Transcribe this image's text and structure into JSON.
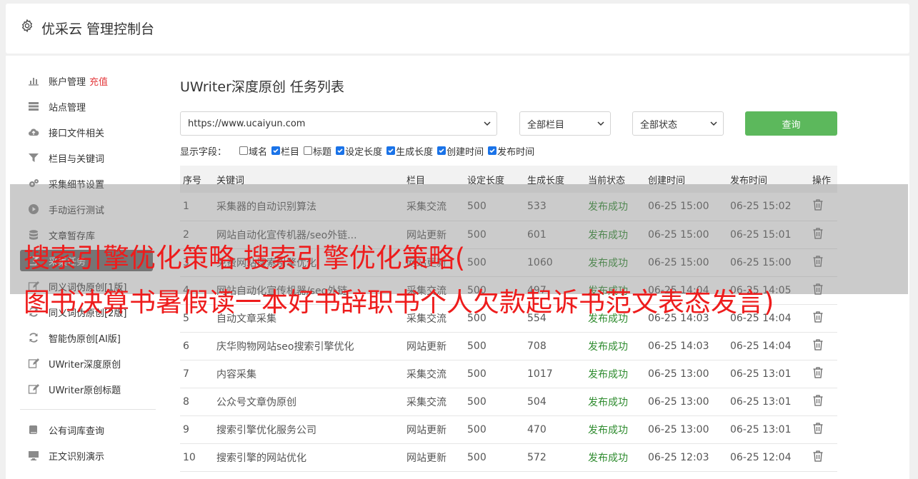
{
  "header": {
    "brand": "优采云 管理控制台",
    "icon": "gear-icon"
  },
  "sidebar": {
    "items": [
      {
        "label": "账户管理",
        "extra": "充值",
        "icon": "bar-chart-icon"
      },
      {
        "label": "站点管理",
        "icon": "server-icon"
      },
      {
        "label": "接口文件相关",
        "icon": "cloud-upload-icon"
      },
      {
        "label": "栏目与关键词",
        "icon": "filter-icon"
      },
      {
        "label": "采集细节设置",
        "icon": "gears-icon"
      },
      {
        "label": "手动运行测试",
        "icon": "play-icon"
      },
      {
        "label": "文章暂存库",
        "icon": "database-icon"
      },
      {
        "label": "采集任务",
        "icon": "edit-icon",
        "active": true
      },
      {
        "label": "同义词伪原创[1版]",
        "icon": "edit-icon"
      },
      {
        "label": "同义词伪原创[2版]",
        "icon": "refresh-icon"
      },
      {
        "label": "智能伪原创[AI版]",
        "icon": "refresh-icon"
      },
      {
        "label": "UWriter深度原创",
        "icon": "edit-icon"
      },
      {
        "label": "UWriter原创标题",
        "icon": "edit-icon"
      }
    ],
    "items2": [
      {
        "label": "公有词库查询",
        "icon": "book-icon"
      },
      {
        "label": "正文识别演示",
        "icon": "monitor-icon"
      }
    ]
  },
  "main": {
    "title": "UWriter深度原创 任务列表",
    "site_select": "https://www.ucaiyun.com",
    "column_select": "全部栏目",
    "status_select": "全部状态",
    "query_label": "查询",
    "fields_label": "显示字段：",
    "fields": [
      {
        "label": "域名",
        "checked": false
      },
      {
        "label": "栏目",
        "checked": true
      },
      {
        "label": "标题",
        "checked": false
      },
      {
        "label": "设定长度",
        "checked": true
      },
      {
        "label": "生成长度",
        "checked": true
      },
      {
        "label": "创建时间",
        "checked": true
      },
      {
        "label": "发布时间",
        "checked": true
      }
    ],
    "table": {
      "headers": [
        "序号",
        "关键词",
        "栏目",
        "设定长度",
        "生成长度",
        "当前状态",
        "创建时间",
        "发布时间",
        "操作"
      ],
      "rows": [
        [
          "1",
          "采集器的自动识别算法",
          "采集交流",
          "500",
          "533",
          "发布成功",
          "06-25 15:00",
          "06-25 15:02"
        ],
        [
          "2",
          "网站自动化宣传机器/seo外链...",
          "网站更新",
          "500",
          "601",
          "发布成功",
          "06-25 15:00",
          "06-25 15:01"
        ],
        [
          "3",
          "免费网站搜索引擎优化",
          "网站更新",
          "500",
          "1060",
          "发布成功",
          "06-25 15:00",
          "06-25 15:00"
        ],
        [
          "4",
          "网站自动化宣传机器/seo外链",
          "采集交流",
          "500",
          "497",
          "发布成功",
          "06-25 14:04",
          "06-25 14:05"
        ],
        [
          "5",
          "自动文章采集",
          "采集交流",
          "500",
          "554",
          "发布成功",
          "06-25 14:03",
          "06-25 14:04"
        ],
        [
          "6",
          "庆华购物网站seo搜索引擎优化",
          "网站更新",
          "500",
          "708",
          "发布成功",
          "06-25 14:03",
          "06-25 14:04"
        ],
        [
          "7",
          "内容采集",
          "采集交流",
          "500",
          "1017",
          "发布成功",
          "06-25 13:00",
          "06-25 13:01"
        ],
        [
          "8",
          "公众号文章伪原创",
          "采集交流",
          "500",
          "504",
          "发布成功",
          "06-25 13:00",
          "06-25 13:01"
        ],
        [
          "9",
          "搜索引擎优化服务公司",
          "网站更新",
          "500",
          "470",
          "发布成功",
          "06-25 13:00",
          "06-25 13:01"
        ],
        [
          "10",
          "搜索引擎的网站优化",
          "网站更新",
          "500",
          "572",
          "发布成功",
          "06-25 12:03",
          "06-25 12:04"
        ]
      ]
    }
  },
  "overlay": {
    "line1": "搜索引擎优化策略 搜索引擎优化策略(",
    "line2": "图书决算书暑假读一本好书辞职书个人欠款起诉书范文表态发言)"
  },
  "colors": {
    "accent": "#5cb85c",
    "status_ok": "#2e8b2e",
    "alert": "#e4393c",
    "overlay_text": "#ee1c1c"
  }
}
